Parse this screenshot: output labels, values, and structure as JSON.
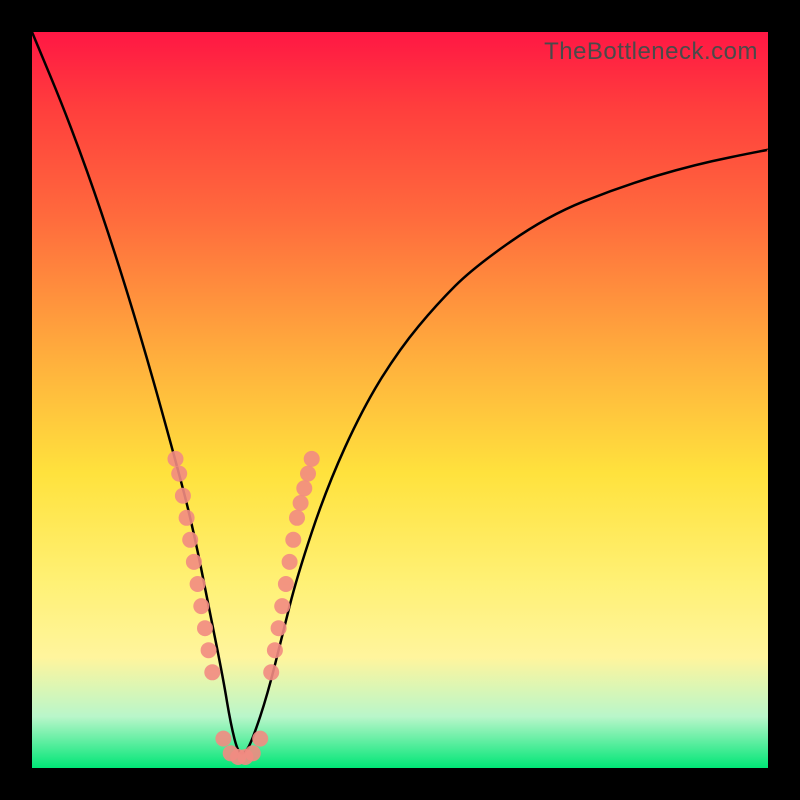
{
  "watermark": "TheBottleneck.com",
  "chart_data": {
    "type": "line",
    "title": "",
    "xlabel": "",
    "ylabel": "",
    "xlim": [
      0,
      100
    ],
    "ylim": [
      0,
      100
    ],
    "x": [
      0,
      5,
      10,
      15,
      20,
      22,
      24,
      26,
      27,
      28,
      29,
      30,
      32,
      34,
      36,
      40,
      45,
      50,
      55,
      60,
      70,
      80,
      90,
      100
    ],
    "series": [
      {
        "name": "bottleneck-curve",
        "values": [
          100,
          88,
          74,
          58,
          40,
          32,
          22,
          12,
          6,
          2,
          2,
          4,
          10,
          18,
          26,
          38,
          49,
          57,
          63,
          68,
          75,
          79,
          82,
          84
        ]
      }
    ],
    "markers": {
      "name": "data-points",
      "color": "#f28b82",
      "points": [
        {
          "x": 19.5,
          "y": 42
        },
        {
          "x": 20.0,
          "y": 40
        },
        {
          "x": 20.5,
          "y": 37
        },
        {
          "x": 21.0,
          "y": 34
        },
        {
          "x": 21.5,
          "y": 31
        },
        {
          "x": 22.0,
          "y": 28
        },
        {
          "x": 22.5,
          "y": 25
        },
        {
          "x": 23.0,
          "y": 22
        },
        {
          "x": 23.5,
          "y": 19
        },
        {
          "x": 24.0,
          "y": 16
        },
        {
          "x": 24.5,
          "y": 13
        },
        {
          "x": 26.0,
          "y": 4
        },
        {
          "x": 27.0,
          "y": 2
        },
        {
          "x": 28.0,
          "y": 1.5
        },
        {
          "x": 29.0,
          "y": 1.5
        },
        {
          "x": 30.0,
          "y": 2
        },
        {
          "x": 31.0,
          "y": 4
        },
        {
          "x": 32.5,
          "y": 13
        },
        {
          "x": 33.0,
          "y": 16
        },
        {
          "x": 33.5,
          "y": 19
        },
        {
          "x": 34.0,
          "y": 22
        },
        {
          "x": 34.5,
          "y": 25
        },
        {
          "x": 35.0,
          "y": 28
        },
        {
          "x": 35.5,
          "y": 31
        },
        {
          "x": 36.0,
          "y": 34
        },
        {
          "x": 36.5,
          "y": 36
        },
        {
          "x": 37.0,
          "y": 38
        },
        {
          "x": 37.5,
          "y": 40
        },
        {
          "x": 38.0,
          "y": 42
        }
      ]
    }
  }
}
